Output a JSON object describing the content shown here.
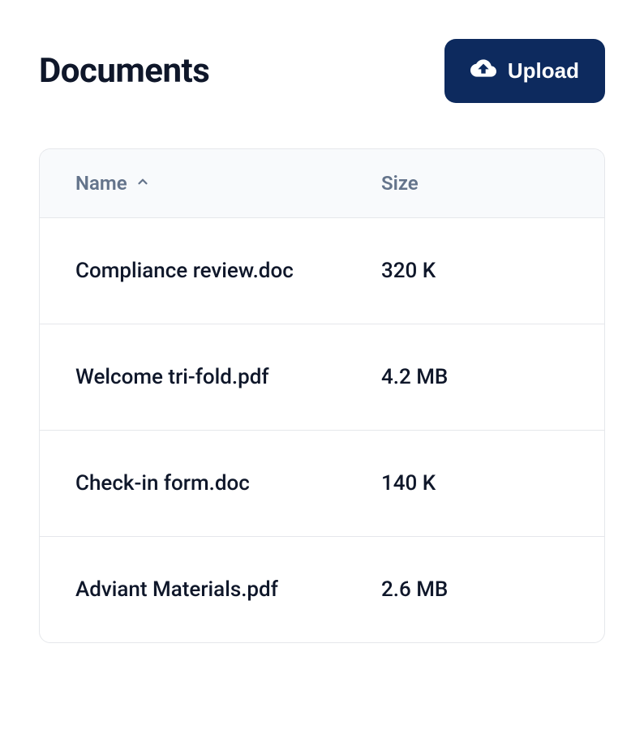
{
  "header": {
    "title": "Documents",
    "upload_button_label": "Upload"
  },
  "table": {
    "columns": {
      "name": "Name",
      "size": "Size"
    },
    "sort": {
      "column": "name",
      "direction": "asc"
    },
    "rows": [
      {
        "name": "Compliance review.doc",
        "size": "320 K"
      },
      {
        "name": "Welcome tri-fold.pdf",
        "size": "4.2 MB"
      },
      {
        "name": "Check-in form.doc",
        "size": "140 K"
      },
      {
        "name": "Adviant Materials.pdf",
        "size": "2.6 MB"
      }
    ]
  }
}
